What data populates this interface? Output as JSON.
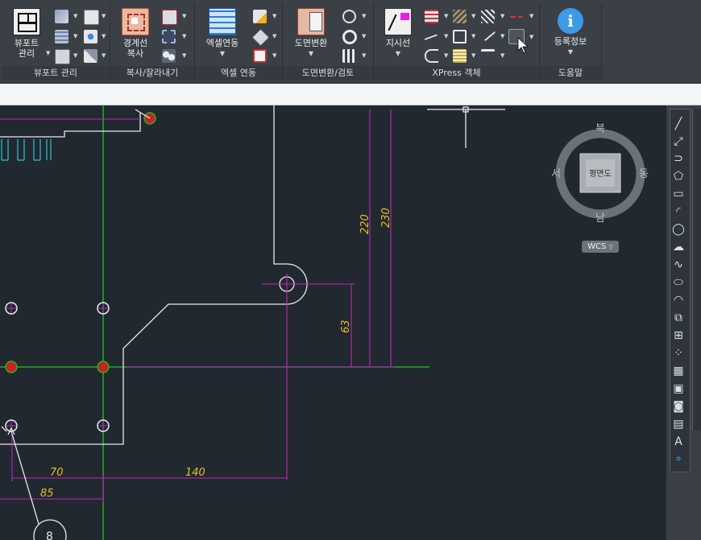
{
  "ribbon": {
    "panels": [
      {
        "title": "뷰포트 관리",
        "big_label_1": "뷰포트",
        "big_label_2": "관리"
      },
      {
        "title": "복사/잘라내기",
        "big_label_1": "경계선",
        "big_label_2": "복사"
      },
      {
        "title": "엑셀 연동",
        "big_label_1": "엑셀연동"
      },
      {
        "title": "도면변환/검토",
        "big_label_1": "도면변환"
      },
      {
        "title": "XPress 객체",
        "big_label_1": "지시선"
      },
      {
        "title": "도움말",
        "big_label_1": "등록정보"
      }
    ]
  },
  "command_line": {
    "value": ""
  },
  "viewcube": {
    "north": "북",
    "south": "남",
    "east": "동",
    "west": "서",
    "face": "평면도",
    "ucs": "WCS"
  },
  "dimensions": {
    "d220": "220",
    "d230": "230",
    "d63": "63",
    "d70": "70",
    "d140": "140",
    "d85": "85"
  },
  "balloon": {
    "number": "8"
  },
  "sidebar_glyphs": {
    "text_tool": "A"
  },
  "colors": {
    "background": "#212830",
    "green": "#1ec81e",
    "magenta": "#c026c0",
    "dim_text": "#e6c020",
    "cyan": "#2ac4d6"
  }
}
